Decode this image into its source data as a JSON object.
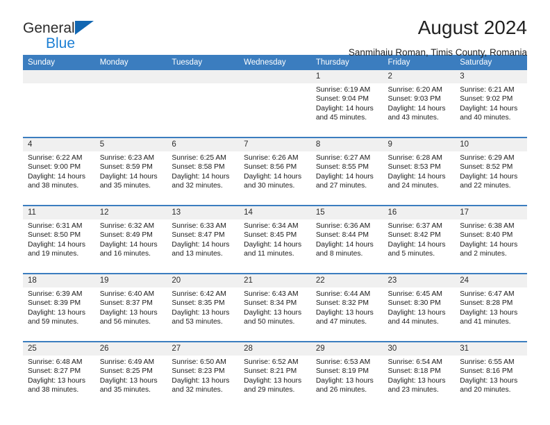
{
  "brand": {
    "name_part1": "General",
    "name_part2": "Blue",
    "logo_icon": "triangle-logo-icon",
    "accent_color": "#1267b2"
  },
  "header": {
    "title": "August 2024",
    "subtitle": "Sanmihaiu Roman, Timis County, Romania"
  },
  "colors": {
    "header_row_bg": "#3b7dbf",
    "daynum_bg": "#f0f0f0",
    "cell_bg": "#ffffff",
    "text": "#1a1a1a"
  },
  "weekday_headers": [
    "Sunday",
    "Monday",
    "Tuesday",
    "Wednesday",
    "Thursday",
    "Friday",
    "Saturday"
  ],
  "weeks": [
    {
      "days": [
        {
          "num": "",
          "sunrise": "",
          "sunset": "",
          "daylight1": "",
          "daylight2": ""
        },
        {
          "num": "",
          "sunrise": "",
          "sunset": "",
          "daylight1": "",
          "daylight2": ""
        },
        {
          "num": "",
          "sunrise": "",
          "sunset": "",
          "daylight1": "",
          "daylight2": ""
        },
        {
          "num": "",
          "sunrise": "",
          "sunset": "",
          "daylight1": "",
          "daylight2": ""
        },
        {
          "num": "1",
          "sunrise": "Sunrise: 6:19 AM",
          "sunset": "Sunset: 9:04 PM",
          "daylight1": "Daylight: 14 hours",
          "daylight2": "and 45 minutes."
        },
        {
          "num": "2",
          "sunrise": "Sunrise: 6:20 AM",
          "sunset": "Sunset: 9:03 PM",
          "daylight1": "Daylight: 14 hours",
          "daylight2": "and 43 minutes."
        },
        {
          "num": "3",
          "sunrise": "Sunrise: 6:21 AM",
          "sunset": "Sunset: 9:02 PM",
          "daylight1": "Daylight: 14 hours",
          "daylight2": "and 40 minutes."
        }
      ]
    },
    {
      "days": [
        {
          "num": "4",
          "sunrise": "Sunrise: 6:22 AM",
          "sunset": "Sunset: 9:00 PM",
          "daylight1": "Daylight: 14 hours",
          "daylight2": "and 38 minutes."
        },
        {
          "num": "5",
          "sunrise": "Sunrise: 6:23 AM",
          "sunset": "Sunset: 8:59 PM",
          "daylight1": "Daylight: 14 hours",
          "daylight2": "and 35 minutes."
        },
        {
          "num": "6",
          "sunrise": "Sunrise: 6:25 AM",
          "sunset": "Sunset: 8:58 PM",
          "daylight1": "Daylight: 14 hours",
          "daylight2": "and 32 minutes."
        },
        {
          "num": "7",
          "sunrise": "Sunrise: 6:26 AM",
          "sunset": "Sunset: 8:56 PM",
          "daylight1": "Daylight: 14 hours",
          "daylight2": "and 30 minutes."
        },
        {
          "num": "8",
          "sunrise": "Sunrise: 6:27 AM",
          "sunset": "Sunset: 8:55 PM",
          "daylight1": "Daylight: 14 hours",
          "daylight2": "and 27 minutes."
        },
        {
          "num": "9",
          "sunrise": "Sunrise: 6:28 AM",
          "sunset": "Sunset: 8:53 PM",
          "daylight1": "Daylight: 14 hours",
          "daylight2": "and 24 minutes."
        },
        {
          "num": "10",
          "sunrise": "Sunrise: 6:29 AM",
          "sunset": "Sunset: 8:52 PM",
          "daylight1": "Daylight: 14 hours",
          "daylight2": "and 22 minutes."
        }
      ]
    },
    {
      "days": [
        {
          "num": "11",
          "sunrise": "Sunrise: 6:31 AM",
          "sunset": "Sunset: 8:50 PM",
          "daylight1": "Daylight: 14 hours",
          "daylight2": "and 19 minutes."
        },
        {
          "num": "12",
          "sunrise": "Sunrise: 6:32 AM",
          "sunset": "Sunset: 8:49 PM",
          "daylight1": "Daylight: 14 hours",
          "daylight2": "and 16 minutes."
        },
        {
          "num": "13",
          "sunrise": "Sunrise: 6:33 AM",
          "sunset": "Sunset: 8:47 PM",
          "daylight1": "Daylight: 14 hours",
          "daylight2": "and 13 minutes."
        },
        {
          "num": "14",
          "sunrise": "Sunrise: 6:34 AM",
          "sunset": "Sunset: 8:45 PM",
          "daylight1": "Daylight: 14 hours",
          "daylight2": "and 11 minutes."
        },
        {
          "num": "15",
          "sunrise": "Sunrise: 6:36 AM",
          "sunset": "Sunset: 8:44 PM",
          "daylight1": "Daylight: 14 hours",
          "daylight2": "and 8 minutes."
        },
        {
          "num": "16",
          "sunrise": "Sunrise: 6:37 AM",
          "sunset": "Sunset: 8:42 PM",
          "daylight1": "Daylight: 14 hours",
          "daylight2": "and 5 minutes."
        },
        {
          "num": "17",
          "sunrise": "Sunrise: 6:38 AM",
          "sunset": "Sunset: 8:40 PM",
          "daylight1": "Daylight: 14 hours",
          "daylight2": "and 2 minutes."
        }
      ]
    },
    {
      "days": [
        {
          "num": "18",
          "sunrise": "Sunrise: 6:39 AM",
          "sunset": "Sunset: 8:39 PM",
          "daylight1": "Daylight: 13 hours",
          "daylight2": "and 59 minutes."
        },
        {
          "num": "19",
          "sunrise": "Sunrise: 6:40 AM",
          "sunset": "Sunset: 8:37 PM",
          "daylight1": "Daylight: 13 hours",
          "daylight2": "and 56 minutes."
        },
        {
          "num": "20",
          "sunrise": "Sunrise: 6:42 AM",
          "sunset": "Sunset: 8:35 PM",
          "daylight1": "Daylight: 13 hours",
          "daylight2": "and 53 minutes."
        },
        {
          "num": "21",
          "sunrise": "Sunrise: 6:43 AM",
          "sunset": "Sunset: 8:34 PM",
          "daylight1": "Daylight: 13 hours",
          "daylight2": "and 50 minutes."
        },
        {
          "num": "22",
          "sunrise": "Sunrise: 6:44 AM",
          "sunset": "Sunset: 8:32 PM",
          "daylight1": "Daylight: 13 hours",
          "daylight2": "and 47 minutes."
        },
        {
          "num": "23",
          "sunrise": "Sunrise: 6:45 AM",
          "sunset": "Sunset: 8:30 PM",
          "daylight1": "Daylight: 13 hours",
          "daylight2": "and 44 minutes."
        },
        {
          "num": "24",
          "sunrise": "Sunrise: 6:47 AM",
          "sunset": "Sunset: 8:28 PM",
          "daylight1": "Daylight: 13 hours",
          "daylight2": "and 41 minutes."
        }
      ]
    },
    {
      "days": [
        {
          "num": "25",
          "sunrise": "Sunrise: 6:48 AM",
          "sunset": "Sunset: 8:27 PM",
          "daylight1": "Daylight: 13 hours",
          "daylight2": "and 38 minutes."
        },
        {
          "num": "26",
          "sunrise": "Sunrise: 6:49 AM",
          "sunset": "Sunset: 8:25 PM",
          "daylight1": "Daylight: 13 hours",
          "daylight2": "and 35 minutes."
        },
        {
          "num": "27",
          "sunrise": "Sunrise: 6:50 AM",
          "sunset": "Sunset: 8:23 PM",
          "daylight1": "Daylight: 13 hours",
          "daylight2": "and 32 minutes."
        },
        {
          "num": "28",
          "sunrise": "Sunrise: 6:52 AM",
          "sunset": "Sunset: 8:21 PM",
          "daylight1": "Daylight: 13 hours",
          "daylight2": "and 29 minutes."
        },
        {
          "num": "29",
          "sunrise": "Sunrise: 6:53 AM",
          "sunset": "Sunset: 8:19 PM",
          "daylight1": "Daylight: 13 hours",
          "daylight2": "and 26 minutes."
        },
        {
          "num": "30",
          "sunrise": "Sunrise: 6:54 AM",
          "sunset": "Sunset: 8:18 PM",
          "daylight1": "Daylight: 13 hours",
          "daylight2": "and 23 minutes."
        },
        {
          "num": "31",
          "sunrise": "Sunrise: 6:55 AM",
          "sunset": "Sunset: 8:16 PM",
          "daylight1": "Daylight: 13 hours",
          "daylight2": "and 20 minutes."
        }
      ]
    }
  ]
}
